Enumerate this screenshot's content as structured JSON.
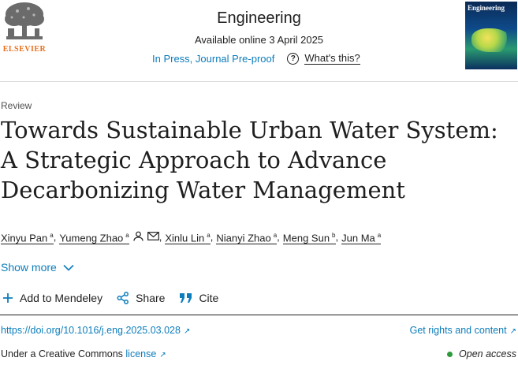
{
  "header": {
    "publisher": "ELSEVIER",
    "journal": "Engineering",
    "available": "Available online 3 April 2025",
    "status": "In Press, Journal Pre-proof",
    "whats_this": "What's this?",
    "cover_title": "Engineering"
  },
  "article": {
    "type": "Review",
    "title": "Towards Sustainable Urban Water System: A Strategic Approach to Advance Decarbonizing Water Management"
  },
  "authors": [
    {
      "name": "Xinyu Pan",
      "aff": "a"
    },
    {
      "name": "Yumeng Zhao",
      "aff": "a"
    },
    {
      "name": "Xinlu Lin",
      "aff": "a"
    },
    {
      "name": "Nianyi Zhao",
      "aff": "a"
    },
    {
      "name": "Meng Sun",
      "aff": "b"
    },
    {
      "name": "Jun Ma",
      "aff": "a"
    }
  ],
  "show_more": "Show more",
  "actions": {
    "mendeley": "Add to Mendeley",
    "share": "Share",
    "cite": "Cite"
  },
  "links": {
    "doi": "https://doi.org/10.1016/j.eng.2025.03.028",
    "rights": "Get rights and content",
    "license_prefix": "Under a Creative Commons",
    "license": "license",
    "open_access": "Open access"
  },
  "colors": {
    "link": "#0c7dbb",
    "brand_orange": "#e9711c",
    "open_access_dot": "#2e9a3a"
  }
}
